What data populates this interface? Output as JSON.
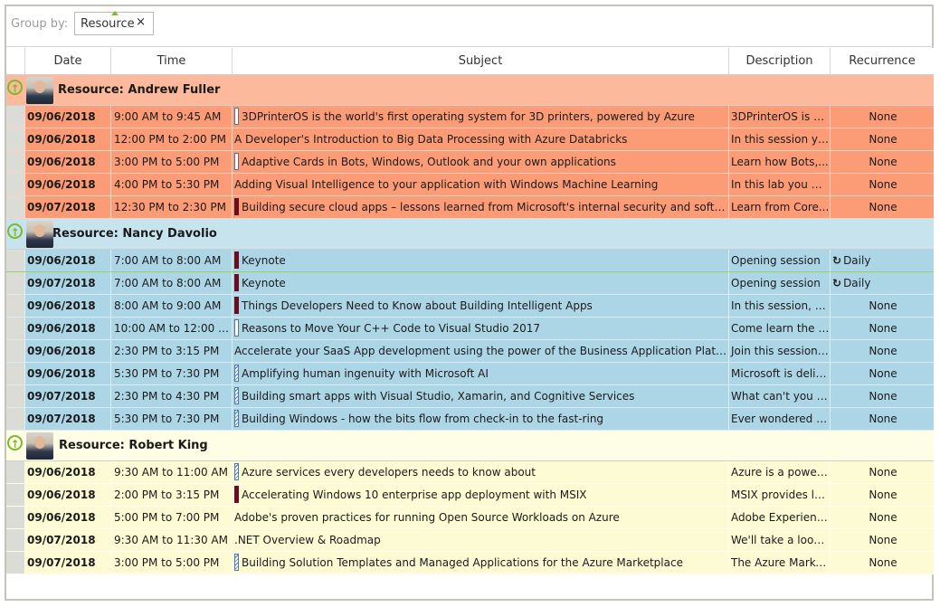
{
  "groupbar": {
    "label": "Group by:",
    "chip": "Resource",
    "close": "×"
  },
  "columns": [
    "Date",
    "Time",
    "Subject",
    "Description",
    "Recurrence"
  ],
  "groups": [
    {
      "title": "Resource: Andrew Fuller",
      "rows": [
        {
          "date": "09/06/2018",
          "time": "9:00 AM to 9:45 AM",
          "mark": "empty",
          "subject": "3DPrinterOS is the world's first operating system for 3D printers, powered by Azure",
          "desc": "3DPrinterOS is an...",
          "rec": "None",
          "recIcon": ""
        },
        {
          "date": "09/06/2018",
          "time": "12:00 PM to 2:00 PM",
          "mark": "none",
          "subject": "A Developer's Introduction to Big Data Processing with Azure Databricks",
          "desc": "In this session yo...",
          "rec": "None",
          "recIcon": ""
        },
        {
          "date": "09/06/2018",
          "time": "3:00 PM to 5:00 PM",
          "mark": "empty",
          "subject": "Adaptive Cards in Bots, Windows, Outlook and your own applications",
          "desc": "Learn how Bots,...",
          "rec": "None",
          "recIcon": ""
        },
        {
          "date": "09/06/2018",
          "time": "4:00 PM to 5:30 PM",
          "mark": "none",
          "subject": "Adding Visual Intelligence to your application with Windows Machine Learning",
          "desc": "In this lab you will...",
          "rec": "None",
          "recIcon": ""
        },
        {
          "date": "09/07/2018",
          "time": "12:30 PM to 2:30 PM",
          "mark": "solid",
          "subject": "Building secure cloud apps – lessons learned from Microsoft's internal security and software engi...",
          "desc": "Learn from Core...",
          "rec": "None",
          "recIcon": ""
        }
      ]
    },
    {
      "title": "Resource: Nancy Davolio",
      "rows": [
        {
          "date": "09/06/2018",
          "time": "7:00 AM to 8:00 AM",
          "mark": "solid",
          "subject": "Keynote",
          "desc": "Opening session",
          "rec": "Daily",
          "recIcon": "↻"
        },
        {
          "date": "09/07/2018",
          "time": "7:00 AM to 8:00 AM",
          "mark": "solid",
          "subject": "Keynote",
          "desc": "Opening session",
          "rec": "Daily",
          "recIcon": "↻"
        },
        {
          "date": "09/06/2018",
          "time": "8:00 AM to 9:00 AM",
          "mark": "solid",
          "subject": "Things Developers Need to Know about Building Intelligent Apps",
          "desc": "In this session, we...",
          "rec": "None",
          "recIcon": ""
        },
        {
          "date": "09/06/2018",
          "time": "10:00 AM to 12:00 PM",
          "mark": "empty",
          "subject": "Reasons to Move Your C++ Code to Visual Studio 2017",
          "desc": "Come learn the t...",
          "rec": "None",
          "recIcon": ""
        },
        {
          "date": "09/06/2018",
          "time": "2:30 PM to 3:15 PM",
          "mark": "none",
          "subject": "Accelerate your SaaS App development using the power of the Business Application Platform",
          "desc": "Join this session t...",
          "rec": "None",
          "recIcon": ""
        },
        {
          "date": "09/06/2018",
          "time": "5:30 PM to 7:30 PM",
          "mark": "hatch",
          "subject": "Amplifying human ingenuity with Microsoft AI",
          "desc": "Microsoft is deliv...",
          "rec": "None",
          "recIcon": ""
        },
        {
          "date": "09/07/2018",
          "time": "2:30 PM to 4:30 PM",
          "mark": "hatch",
          "subject": "Building smart apps with Visual Studio, Xamarin, and Cognitive Services",
          "desc": "What can't you d...",
          "rec": "None",
          "recIcon": ""
        },
        {
          "date": "09/07/2018",
          "time": "5:30 PM to 7:30 PM",
          "mark": "hatch",
          "subject": "Building Windows - how the bits flow from check-in to the fast-ring",
          "desc": "Ever wondered h...",
          "rec": "None",
          "recIcon": ""
        }
      ]
    },
    {
      "title": "Resource: Robert King",
      "rows": [
        {
          "date": "09/06/2018",
          "time": "9:30 AM to 11:00 AM",
          "mark": "hatch",
          "subject": "Azure services every developers needs to know about",
          "desc": "Azure is a powerf...",
          "rec": "None",
          "recIcon": ""
        },
        {
          "date": "09/06/2018",
          "time": "2:00 PM to 3:15 PM",
          "mark": "solid",
          "subject": "Accelerating Windows 10 enterprise app deployment with MSIX",
          "desc": "MSIX provides lot...",
          "rec": "None",
          "recIcon": ""
        },
        {
          "date": "09/06/2018",
          "time": "5:00 PM to 7:00 PM",
          "mark": "none",
          "subject": "Adobe's proven practices for running Open Source Workloads on Azure",
          "desc": "Adobe Experience...",
          "rec": "None",
          "recIcon": ""
        },
        {
          "date": "09/07/2018",
          "time": "9:30 AM to 11:30 AM",
          "mark": "none",
          "subject": ".NET Overview & Roadmap",
          "desc": "We'll take a look...",
          "rec": "None",
          "recIcon": ""
        },
        {
          "date": "09/07/2018",
          "time": "3:00 PM to 5:00 PM",
          "mark": "hatch",
          "subject": "Building Solution Templates and Managed Applications for the Azure Marketplace",
          "desc": "The Azure Market...",
          "rec": "None",
          "recIcon": ""
        }
      ]
    }
  ]
}
